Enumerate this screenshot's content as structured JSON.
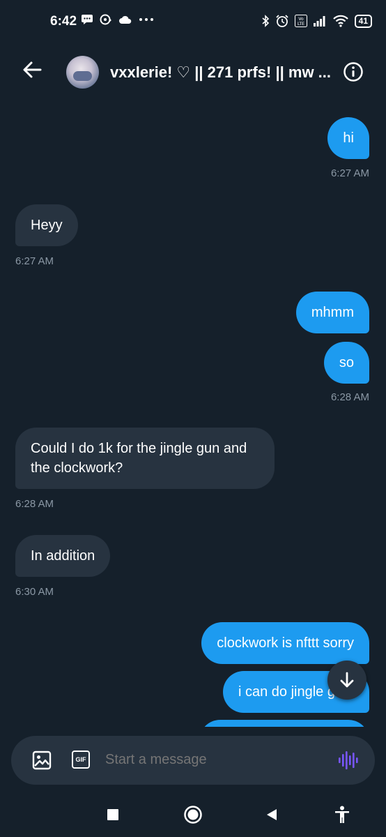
{
  "status_bar": {
    "time": "6:42",
    "battery": "41",
    "left_icons": [
      "message-icon",
      "chat-bubble-icon",
      "cloud-icon",
      "more-dots-icon"
    ],
    "right_icons": [
      "bluetooth-icon",
      "alarm-icon",
      "volte-icon",
      "signal-icon",
      "wifi-icon"
    ]
  },
  "header": {
    "title": "vxxlerie! ♡ || 271 prfs! || mw ...",
    "back_icon": "arrow-left-icon",
    "info_icon": "info-icon"
  },
  "messages": [
    {
      "dir": "out",
      "text": "hi"
    },
    {
      "dir": "ts-out",
      "text": "6:27 AM"
    },
    {
      "dir": "in",
      "text": "Heyy"
    },
    {
      "dir": "ts-in",
      "text": "6:27 AM"
    },
    {
      "dir": "out",
      "text": "mhmm"
    },
    {
      "dir": "out",
      "text": "so"
    },
    {
      "dir": "ts-out",
      "text": "6:28 AM"
    },
    {
      "dir": "in",
      "text": "Could I do 1k for the jingle gun and the clockwork?"
    },
    {
      "dir": "ts-in",
      "text": "6:28 AM"
    },
    {
      "dir": "in",
      "text": "In addition"
    },
    {
      "dir": "ts-in",
      "text": "6:30 AM"
    },
    {
      "dir": "out",
      "text": "clockwork is nfttt sorry"
    },
    {
      "dir": "out",
      "text": "i can do jingle g"
    }
  ],
  "composer": {
    "placeholder": "Start a message",
    "gif_label": "GIF",
    "image_icon": "image-icon",
    "voice_icon": "voice-waveform-icon"
  },
  "scroll_button_icon": "arrow-down-icon",
  "nav_bar": [
    "recents-square-icon",
    "home-circle-icon",
    "back-triangle-icon",
    "accessibility-icon"
  ],
  "colors": {
    "background": "#15202b",
    "outgoing_bubble": "#1d9bf0",
    "incoming_bubble": "#273340",
    "timestamp": "#8b98a5",
    "voice_accent": "#7856ff"
  }
}
